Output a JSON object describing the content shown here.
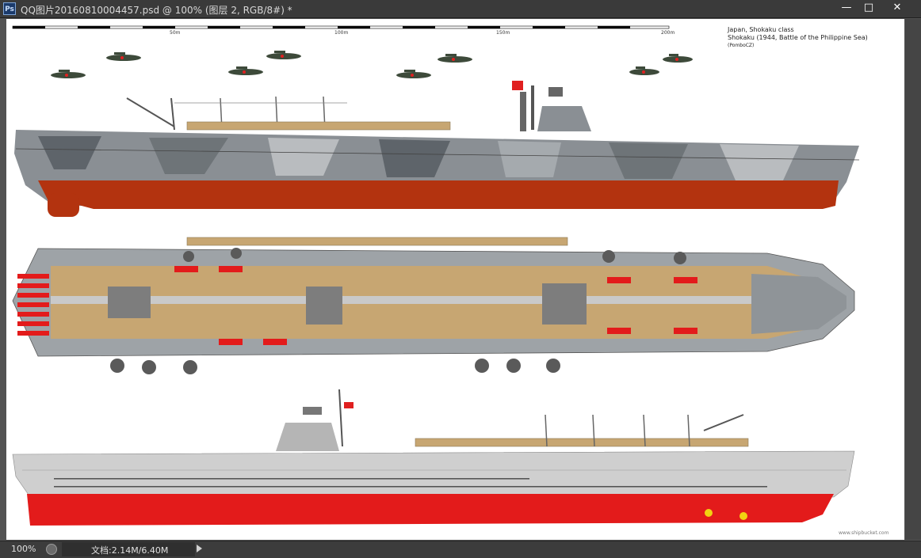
{
  "window": {
    "title": "QQ图片20160810004457.psd @ 100% (图层 2, RGB/8#) *",
    "app_icon": "Ps",
    "minimize_glyph": "—",
    "maximize_glyph": "□",
    "close_glyph": "✕"
  },
  "status": {
    "zoom": "100%",
    "doc_info": "文档:2.14M/6.40M"
  },
  "artwork": {
    "scale_labels": [
      "50m",
      "100m",
      "150m",
      "200m"
    ],
    "header_line1": "Japan, Shokaku class",
    "header_line2": "Shokaku (1944, Battle of the Philippine Sea)",
    "header_line3": "(PomboCZ)",
    "credit": "www.shipbucket.com"
  },
  "colors": {
    "hull_red": "#b3330f",
    "camo_gray": "#8a8f94",
    "deck_tan": "#c7a672",
    "light_hull": "#cfcfcf",
    "bright_red": "#e31b1b"
  }
}
